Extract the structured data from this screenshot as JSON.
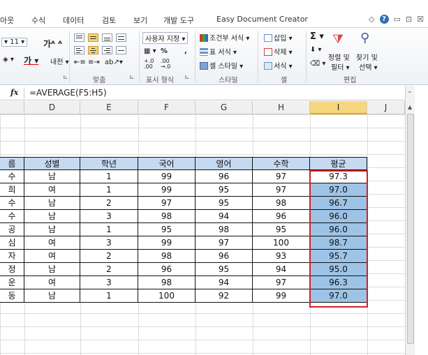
{
  "menu": {
    "tabs": [
      "아웃",
      "수식",
      "데이터",
      "검토",
      "보기",
      "개발 도구",
      "Easy Document Creator"
    ],
    "window_controls": [
      "◇",
      "?",
      "▭",
      "⊡",
      "☒"
    ]
  },
  "ribbon": {
    "font_size": "11",
    "number_format": "사용자 지정",
    "percent": "%",
    "comma": ",",
    "decimals_up": "+.0\n.00",
    "decimals_down": ".00\n→.0",
    "conditional_format": "조건부 서식",
    "table_format": "표 서식",
    "cell_style": "셀 스타일",
    "insert": "삽입",
    "delete": "삭제",
    "format": "서식",
    "sum_symbol": "Σ",
    "sort_filter": "정렬 및",
    "sort_filter2": "필터",
    "find_select": "찾기 및",
    "find_select2": "선택",
    "group_labels": {
      "align": "맞춤",
      "number": "표시 형식",
      "style": "스타일",
      "cells": "셀",
      "editing": "편집"
    }
  },
  "formula_bar": {
    "fx": "fx",
    "formula": "=AVERAGE(F5:H5)"
  },
  "columns": [
    "D",
    "E",
    "F",
    "G",
    "H",
    "I",
    "J"
  ],
  "selected_column": "I",
  "table": {
    "headers": [
      "름",
      "성별",
      "학년",
      "국어",
      "영어",
      "수학",
      "평균"
    ],
    "rows": [
      [
        "수",
        "남",
        "1",
        "99",
        "96",
        "97",
        "97.3"
      ],
      [
        "희",
        "여",
        "1",
        "99",
        "95",
        "97",
        "97.0"
      ],
      [
        "수",
        "남",
        "2",
        "97",
        "95",
        "98",
        "96.7"
      ],
      [
        "수",
        "남",
        "3",
        "98",
        "94",
        "96",
        "96.0"
      ],
      [
        "공",
        "남",
        "1",
        "95",
        "98",
        "95",
        "96.0"
      ],
      [
        "심",
        "여",
        "3",
        "99",
        "97",
        "100",
        "98.7"
      ],
      [
        "자",
        "여",
        "2",
        "98",
        "96",
        "93",
        "95.7"
      ],
      [
        "정",
        "남",
        "2",
        "96",
        "95",
        "94",
        "95.0"
      ],
      [
        "운",
        "여",
        "3",
        "98",
        "94",
        "97",
        "96.3"
      ],
      [
        "동",
        "남",
        "1",
        "100",
        "92",
        "99",
        "97.0"
      ]
    ]
  },
  "colors": {
    "header_fill": "#c5d9f1",
    "selection_fill": "#9dc3e6",
    "selection_border": "#d51f24",
    "selected_col_header": "#f6d67e"
  }
}
